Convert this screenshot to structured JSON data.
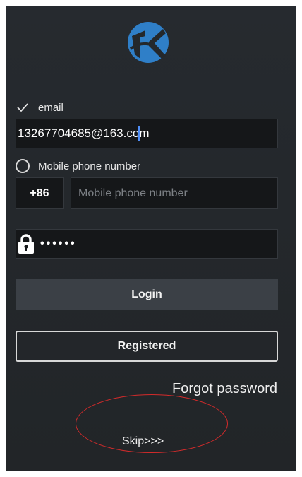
{
  "login_options": {
    "email_label": "email",
    "email_value_before_caret": "13267704685@163.co",
    "email_value_after_caret": "m",
    "mobile_label": "Mobile phone number",
    "country_code": "+86",
    "mobile_placeholder": "Mobile phone number",
    "password_mask": "••••••"
  },
  "actions": {
    "login_label": "Login",
    "register_label": "Registered",
    "forgot_label": "Forgot password",
    "skip_label": "Skip>>>"
  },
  "colors": {
    "background": "#24282c",
    "login_button": "#3b4046",
    "logo_blue": "#2f7fc8",
    "annotation_red": "#d42b2b"
  },
  "icons": [
    "app-logo-icon",
    "checkmark-icon",
    "radio-circle-icon",
    "lock-icon"
  ]
}
